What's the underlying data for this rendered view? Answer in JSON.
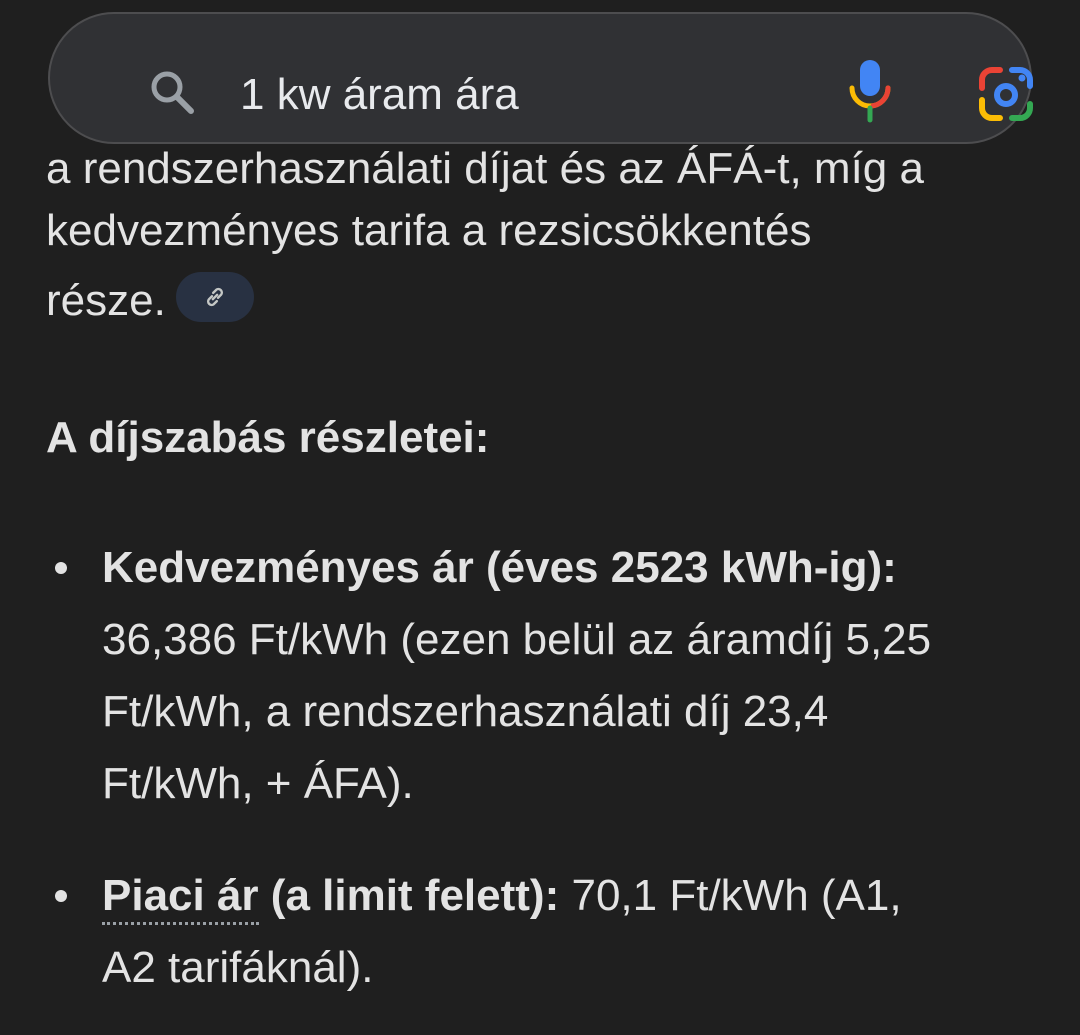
{
  "search": {
    "query": "1 kw áram ára",
    "icons": {
      "search": "search-icon",
      "voice": "microphone-icon",
      "lens": "google-lens-icon"
    }
  },
  "answer": {
    "clipped_line": "a rendszerhasználati díjat és az ÁFÁ-t, míg a",
    "intro_lines": [
      "kedvezményes tarifa a rezsicsökkentés",
      "része."
    ],
    "link_chip_icon": "link-icon",
    "section_heading": "A díjszabás részletei:",
    "bullets": [
      {
        "title": "Kedvezményes ár (éves 2523 kWh-ig):",
        "lines": [
          "36,386 Ft/kWh (ezen belül az áramdíj 5,25",
          "Ft/kWh, a rendszerhasználati díj 23,4",
          "Ft/kWh, + ÁFA)."
        ]
      },
      {
        "title_underlined": "Piaci ár",
        "title_rest": " (a limit felett):",
        "first_line_rest": " 70,1 Ft/kWh (A1,",
        "lines": [
          "A2 tarifáknál)."
        ]
      }
    ]
  },
  "colors": {
    "background": "#1f1f1f",
    "search_bar": "#303134",
    "text": "#e3e3e3",
    "chip": "#283142"
  }
}
